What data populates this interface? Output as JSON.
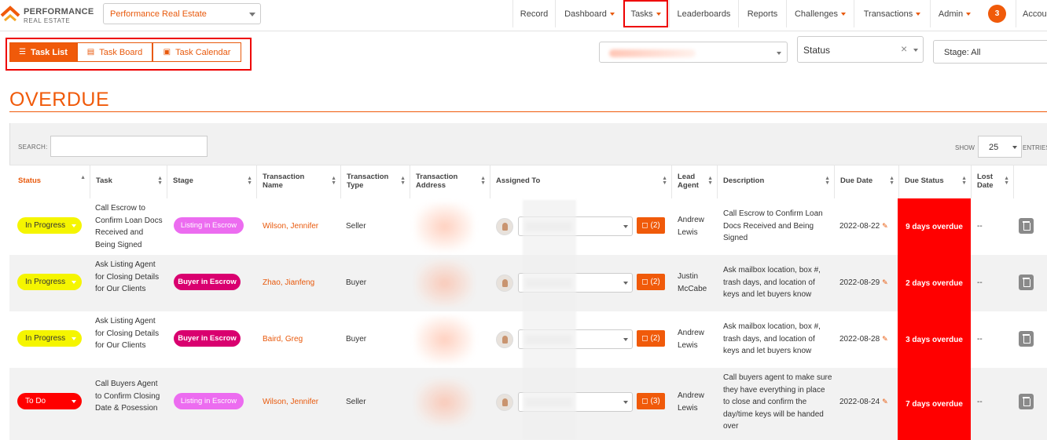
{
  "brand": {
    "line1": "PERFORMANCE",
    "line2": "REAL ESTATE",
    "selected_company": "Performance Real Estate"
  },
  "nav": {
    "record": "Record",
    "dashboard": "Dashboard",
    "tasks": "Tasks",
    "leaderboards": "Leaderboards",
    "reports": "Reports",
    "challenges": "Challenges",
    "transactions": "Transactions",
    "admin": "Admin",
    "notifications": "3",
    "account": "Accou"
  },
  "views": {
    "list": "Task List",
    "board": "Task Board",
    "calendar": "Task Calendar"
  },
  "filters": {
    "status": "Status",
    "stage": "Stage: All"
  },
  "section": {
    "title": "OVERDUE"
  },
  "table_controls": {
    "search_label": "SEARCH:",
    "show_label": "SHOW",
    "page_size": "25",
    "entries_label": "ENTRIES"
  },
  "columns": {
    "status": "Status",
    "task": "Task",
    "stage": "Stage",
    "tx_name": "Transaction Name",
    "tx_type": "Transaction Type",
    "tx_address": "Transaction Address",
    "assigned": "Assigned To",
    "lead_agent": "Lead Agent",
    "description": "Description",
    "due_date": "Due Date",
    "due_status": "Due Status",
    "lost_date": "Lost Date"
  },
  "rows": [
    {
      "status": "In Progress",
      "task": "Call Escrow to Confirm Loan Docs Received and Being Signed",
      "stage": "Listing in Escrow",
      "tx_name": "Wilson, Jennifer",
      "tx_type": "Seller",
      "comments": "(2)",
      "lead_agent": "Andrew Lewis",
      "description": "Call Escrow to Confirm Loan Docs Received and Being Signed",
      "due_date": "2022-08-22",
      "due_status": "9 days overdue",
      "lost_date": "--"
    },
    {
      "status": "In Progress",
      "task": "Ask Listing Agent for Closing Details for Our Clients",
      "stage": "Buyer in Escrow",
      "tx_name": "Zhao, Jianfeng",
      "tx_type": "Buyer",
      "comments": "(2)",
      "lead_agent": "Justin McCabe",
      "description": "Ask mailbox location, box #, trash days, and location of keys and let buyers know",
      "due_date": "2022-08-29",
      "due_status": "2 days overdue",
      "lost_date": "--"
    },
    {
      "status": "In Progress",
      "task": "Ask Listing Agent for Closing Details for Our Clients",
      "stage": "Buyer in Escrow",
      "tx_name": "Baird, Greg",
      "tx_type": "Buyer",
      "comments": "(2)",
      "lead_agent": "Andrew Lewis",
      "description": "Ask mailbox location, box #, trash days, and location of keys and let buyers know",
      "due_date": "2022-08-28",
      "due_status": "3 days overdue",
      "lost_date": "--"
    },
    {
      "status": "To Do",
      "task": "Call Buyers Agent to Confirm Closing Date & Posession",
      "stage": "Listing in Escrow",
      "tx_name": "Wilson, Jennifer",
      "tx_type": "Seller",
      "comments": "(3)",
      "lead_agent": "Andrew Lewis",
      "description": "Call buyers agent to make sure they have everything in place to close and confirm the day/time keys will be handed over",
      "due_date": "2022-08-24",
      "due_status": "7 days overdue",
      "lost_date": "--"
    }
  ],
  "colors": {
    "accent": "#f05a0a",
    "overdue": "#ff0000",
    "in_progress": "#f5f500",
    "listing_pill": "#ec6cf0",
    "buyer_pill": "#d9006f"
  }
}
